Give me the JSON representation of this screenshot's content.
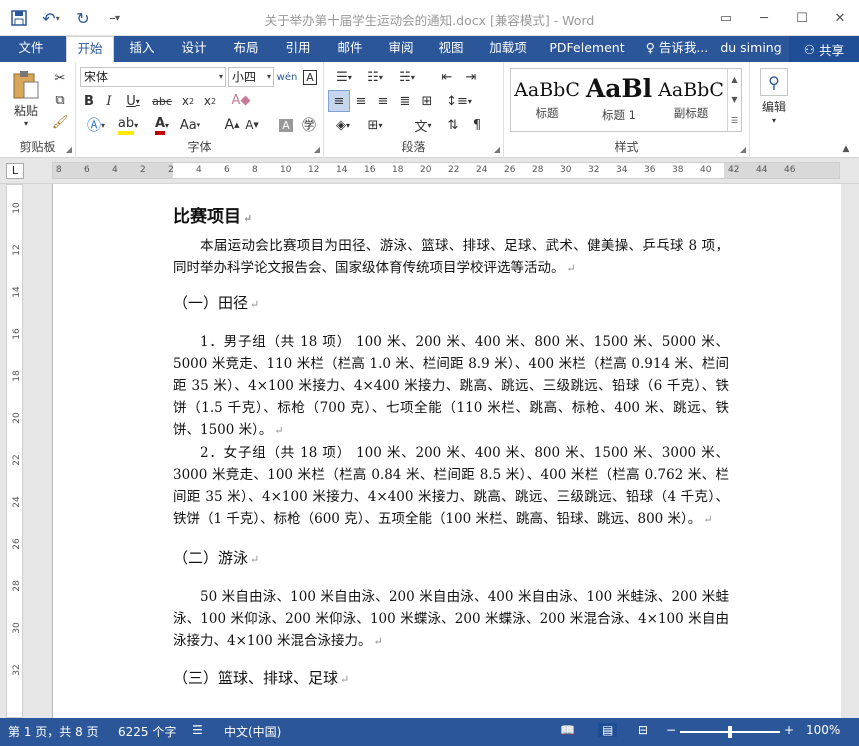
{
  "window": {
    "title": "关于举办第十届学生运动会的通知.docx [兼容模式] - Word"
  },
  "tabs": [
    "文件",
    "开始",
    "插入",
    "设计",
    "布局",
    "引用",
    "邮件",
    "审阅",
    "视图",
    "加载项",
    "PDFelement"
  ],
  "tell_me": "告诉我...",
  "user": "du siming",
  "share": "共享",
  "ribbon": {
    "paste": "粘贴",
    "clipboard_label": "剪贴板",
    "font_label": "字体",
    "paragraph_label": "段落",
    "styles_label": "样式",
    "edit_label": "编辑",
    "font_name": "宋体",
    "font_size": "小四",
    "styles": [
      {
        "sample": "AaBbC",
        "name": "标题"
      },
      {
        "sample": "AaBl",
        "name": "标题 1"
      },
      {
        "sample": "AaBbC",
        "name": "副标题"
      }
    ]
  },
  "ruler": {
    "ticks": [
      "8",
      "6",
      "4",
      "2",
      "2",
      "4",
      "6",
      "8",
      "10",
      "12",
      "14",
      "16",
      "18",
      "20",
      "22",
      "24",
      "26",
      "28",
      "30",
      "32",
      "34",
      "36",
      "38",
      "40",
      "42",
      "44",
      "46"
    ],
    "vticks": [
      "10",
      "12",
      "14",
      "16",
      "18",
      "20",
      "22",
      "24",
      "26",
      "28",
      "30",
      "32"
    ]
  },
  "document": {
    "heading": "比赛项目",
    "intro": "本届运动会比赛项目为田径、游泳、篮球、排球、足球、武术、健美操、乒乓球 8 项，同时举办科学论文报告会、国家级体育传统项目学校评选等活动。",
    "sec1": "（一）田径",
    "men": "1．男子组（共 18 项） 100 米、200 米、400 米、800 米、1500 米、5000 米、5000 米竞走、110 米栏（栏高 1.0 米、栏间距 8.9 米）、400 米栏（栏高 0.914 米、栏间距 35 米）、4×100 米接力、4×400 米接力、跳高、跳远、三级跳远、铅球（6 千克）、铁饼（1.5 千克）、标枪（700 克）、七项全能（110 米栏、跳高、标枪、400 米、跳远、铁饼、1500 米）。",
    "women": "2．女子组（共 18 项） 100 米、200 米、400 米、800 米、1500 米、3000 米、3000 米竞走、100 米栏（栏高 0.84 米、栏间距 8.5 米）、400 米栏（栏高 0.762 米、栏间距 35 米）、4×100 米接力、4×400 米接力、跳高、跳远、三级跳远、铅球（4 千克）、铁饼（1 千克）、标枪（600 克）、五项全能（100 米栏、跳高、铅球、跳远、800 米）。",
    "sec2": "（二）游泳",
    "swim": "50 米自由泳、100 米自由泳、200 米自由泳、400 米自由泳、100 米蛙泳、200 米蛙泳、100 米仰泳、200 米仰泳、100 米蝶泳、200 米蝶泳、200 米混合泳、4×100 米自由泳接力、4×100 米混合泳接力。",
    "sec3": "（三）篮球、排球、足球"
  },
  "status": {
    "page": "第 1 页，共 8 页",
    "words": "6225 个字",
    "lang": "中文(中国)",
    "zoom": "100%"
  },
  "colors": {
    "accent": "#2b579a"
  }
}
